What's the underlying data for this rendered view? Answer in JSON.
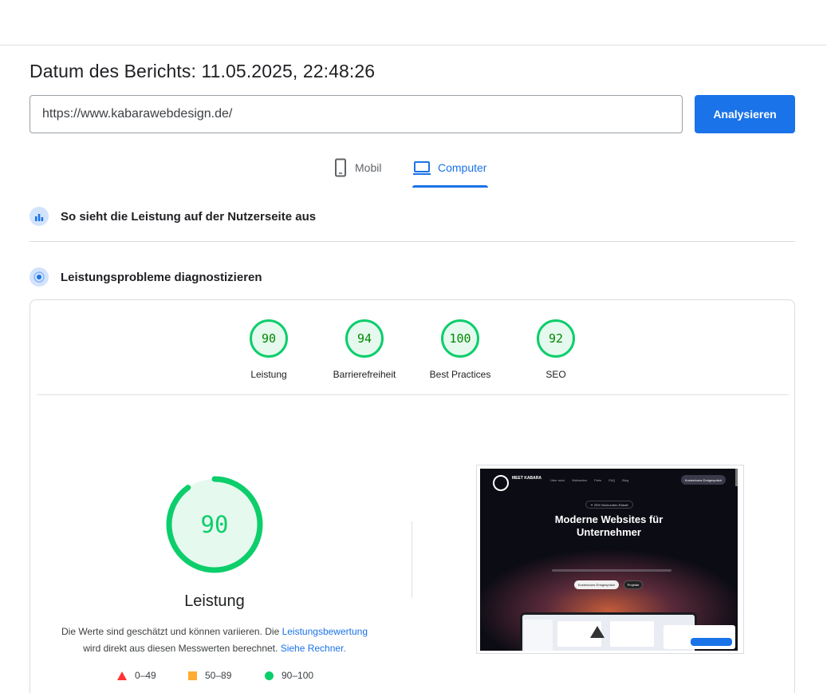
{
  "report": {
    "date_label": "Datum des Berichts: 11.05.2025, 22:48:26"
  },
  "search": {
    "url_value": "https://www.kabarawebdesign.de/",
    "analyze_label": "Analysieren"
  },
  "device_tabs": {
    "mobile_label": "Mobil",
    "desktop_label": "Computer",
    "active": "Computer",
    "mobile_icon": "smartphone-icon",
    "desktop_icon": "laptop-icon"
  },
  "sections": {
    "field_data_title": "So sieht die Leistung auf der Nutzerseite aus",
    "field_data_icon": "field-data-icon",
    "diagnose_title": "Leistungsprobleme diagnostizieren",
    "diagnose_icon": "lab-data-icon"
  },
  "scores": [
    {
      "label": "Leistung",
      "value": "90"
    },
    {
      "label": "Barrierefreiheit",
      "value": "94"
    },
    {
      "label": "Best Practices",
      "value": "100"
    },
    {
      "label": "SEO",
      "value": "92"
    }
  ],
  "performance": {
    "score": "90",
    "score_fraction": 0.9,
    "title": "Leistung",
    "note_part1": "Die Werte sind geschätzt und können variieren. Die ",
    "note_link1": "Leistungsbewertung",
    "note_part2": "wird direkt aus diesen Messwerten berechnet. ",
    "note_link2": "Siehe Rechner."
  },
  "legend": {
    "poor": "0–49",
    "average": "50–89",
    "good": "90–100"
  },
  "colors": {
    "accent": "#1a73e8",
    "pass": "#0cce6b",
    "average": "#ffaa33",
    "fail": "#ff3333"
  },
  "screenshot": {
    "brand": "MEET KABARA",
    "nav": [
      "Über mich",
      "Webseiten",
      "Preis",
      "FAQ",
      "Blog"
    ],
    "cta": "Kostenloses Erstgespräch",
    "badge": "✦ 25% Neukunden-Rabatt",
    "headline": "Moderne Websites für Unternehmer",
    "button_primary": "Kostenloses Erstgespräch",
    "button_secondary": "Projekte"
  }
}
